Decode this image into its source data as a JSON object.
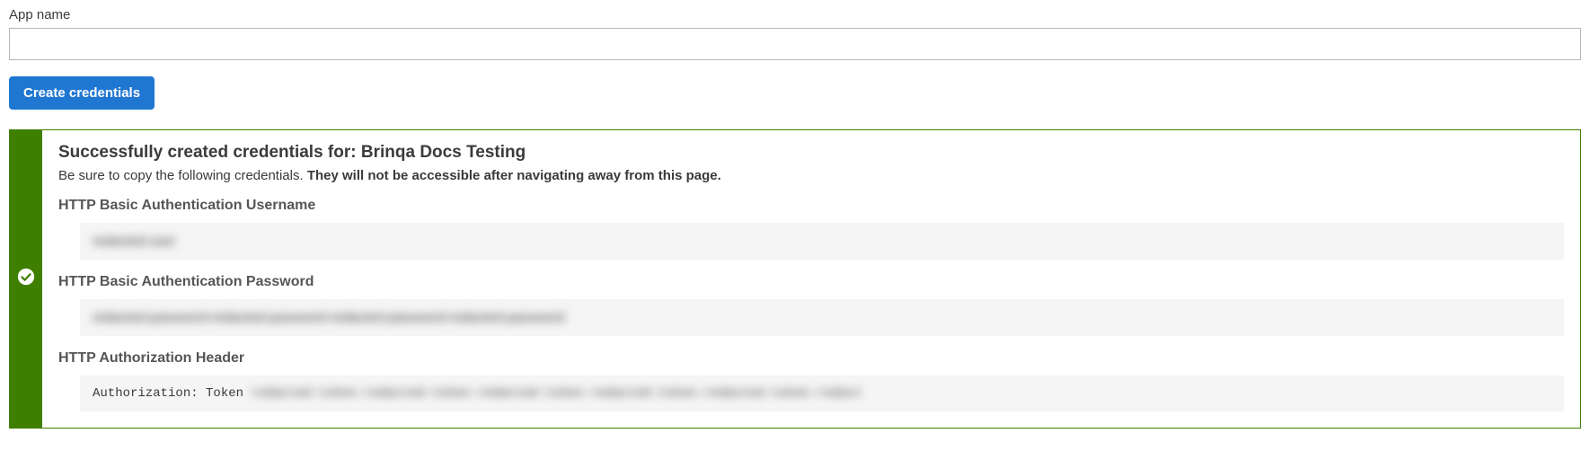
{
  "form": {
    "app_name_label": "App name",
    "app_name_value": "",
    "create_button": "Create credentials"
  },
  "alert": {
    "title_prefix": "Successfully created credentials for: ",
    "app_name": "Brinqa Docs Testing",
    "desc_plain": "Be sure to copy the following credentials. ",
    "desc_bold": "They will not be accessible after navigating away from this page.",
    "sections": {
      "username_label": "HTTP Basic Authentication Username",
      "username_value": "redacted-user",
      "password_label": "HTTP Basic Authentication Password",
      "password_value": "redacted-password-redacted-password-redacted-password-redacted-password",
      "header_label": "HTTP Authorization Header",
      "header_prefix": "Authorization: Token ",
      "header_value": "redacted-token-redacted-token-redacted-token-redacted-token-redacted-token-redact"
    }
  }
}
